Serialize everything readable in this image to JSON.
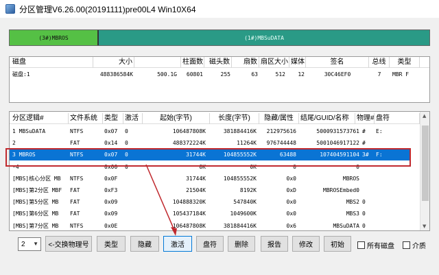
{
  "window": {
    "title": "分区管理V6.26.00(20191111)pre00L4 Win10X64"
  },
  "partition_bar": [
    {
      "label": "(3#)MBROS",
      "color": "#55c045"
    },
    {
      "label": "(1#)MBSuDATA",
      "color": "#2a9a86"
    }
  ],
  "disk_table": {
    "headers": [
      "磁盘",
      "大小",
      "",
      "柱面数",
      "磁头数",
      "扇数",
      "扇区大小",
      "媒体",
      "签名",
      "总线",
      "类型"
    ],
    "rows": [
      [
        "磁盘:1",
        "488386584K",
        "500.1G",
        "60801",
        "255",
        "63",
        "512",
        "12",
        "30C46EF0",
        "7",
        "MBR F"
      ]
    ]
  },
  "part_table": {
    "headers": [
      "分区逻辑#",
      "文件系统",
      "类型",
      "激活",
      "起始(字节)",
      "长度(字节)",
      "隐藏/属性",
      "结尾/GUID/名称",
      "物理#",
      "盘符"
    ],
    "rows": [
      [
        "1 MBSuDATA",
        "NTFS",
        "0x07",
        "0",
        "106487808K",
        "381884416K",
        "212975616",
        "5000931573761",
        "#",
        "E:"
      ],
      [
        "2",
        "FAT",
        "0x14",
        "0",
        "488372224K",
        "11264K",
        "976744448",
        "5001046917122",
        "#",
        ""
      ],
      [
        "3 MBROS",
        "NTFS",
        "0x07",
        "0",
        "31744K",
        "104855552K",
        "63488",
        "107404591104",
        "3#",
        "F:"
      ],
      [
        "-4",
        "",
        "0x00",
        "0",
        "0K",
        "0K",
        "0",
        "0",
        "",
        ""
      ],
      [
        "[MBS]核心分区 MB",
        "NTFS",
        "0x0F",
        "",
        "31744K",
        "104855552K",
        "0x0",
        "MBROS",
        "",
        ""
      ],
      [
        "[MBS]第2分区 MBF",
        "FAT",
        "0xF3",
        "",
        "21504K",
        "8192K",
        "0xD",
        "MBROSEmbed0",
        "",
        ""
      ],
      [
        "[MBS]第5分区 MB",
        "FAT",
        "0x09",
        "",
        "104888320K",
        "547840K",
        "0x0",
        "MBS2",
        "0",
        ""
      ],
      [
        "[MBS]第6分区 MB",
        "FAT",
        "0x09",
        "",
        "105437184K",
        "1049600K",
        "0x0",
        "MBS3",
        "0",
        ""
      ],
      [
        "[MBS]第7分区 MB",
        "NTFS",
        "0x0E",
        "",
        "106487808K",
        "381884416K",
        "0x6",
        "MBSuDATA",
        "0",
        ""
      ]
    ],
    "selected_index": 2
  },
  "toolbar": {
    "disk_select": "2",
    "swap_btn": "<-交换物理号",
    "type_btn": "类型",
    "hide_btn": "隐藏",
    "activate_btn": "激活",
    "drive_btn": "盘符",
    "delete_btn": "删除",
    "report_btn": "报告",
    "modify_btn": "修改",
    "init_btn": "初始",
    "all_disks_label": "所有磁盘",
    "media_label": "介质"
  }
}
